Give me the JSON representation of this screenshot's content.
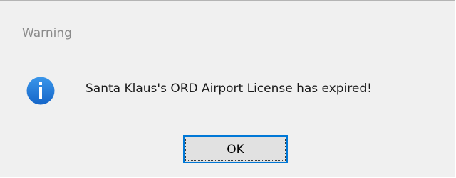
{
  "window": {
    "title": "Warning"
  },
  "dialog": {
    "icon": "info-icon",
    "message": "Santa Klaus's ORD Airport License has expired!"
  },
  "buttons": {
    "ok_mnemonic": "O",
    "ok_rest": "K"
  },
  "colors": {
    "dialog_background": "#f0f0f0",
    "icon_blue": "#1a73d9",
    "button_border": "#0078d7",
    "title_text": "#8a8a8a"
  }
}
